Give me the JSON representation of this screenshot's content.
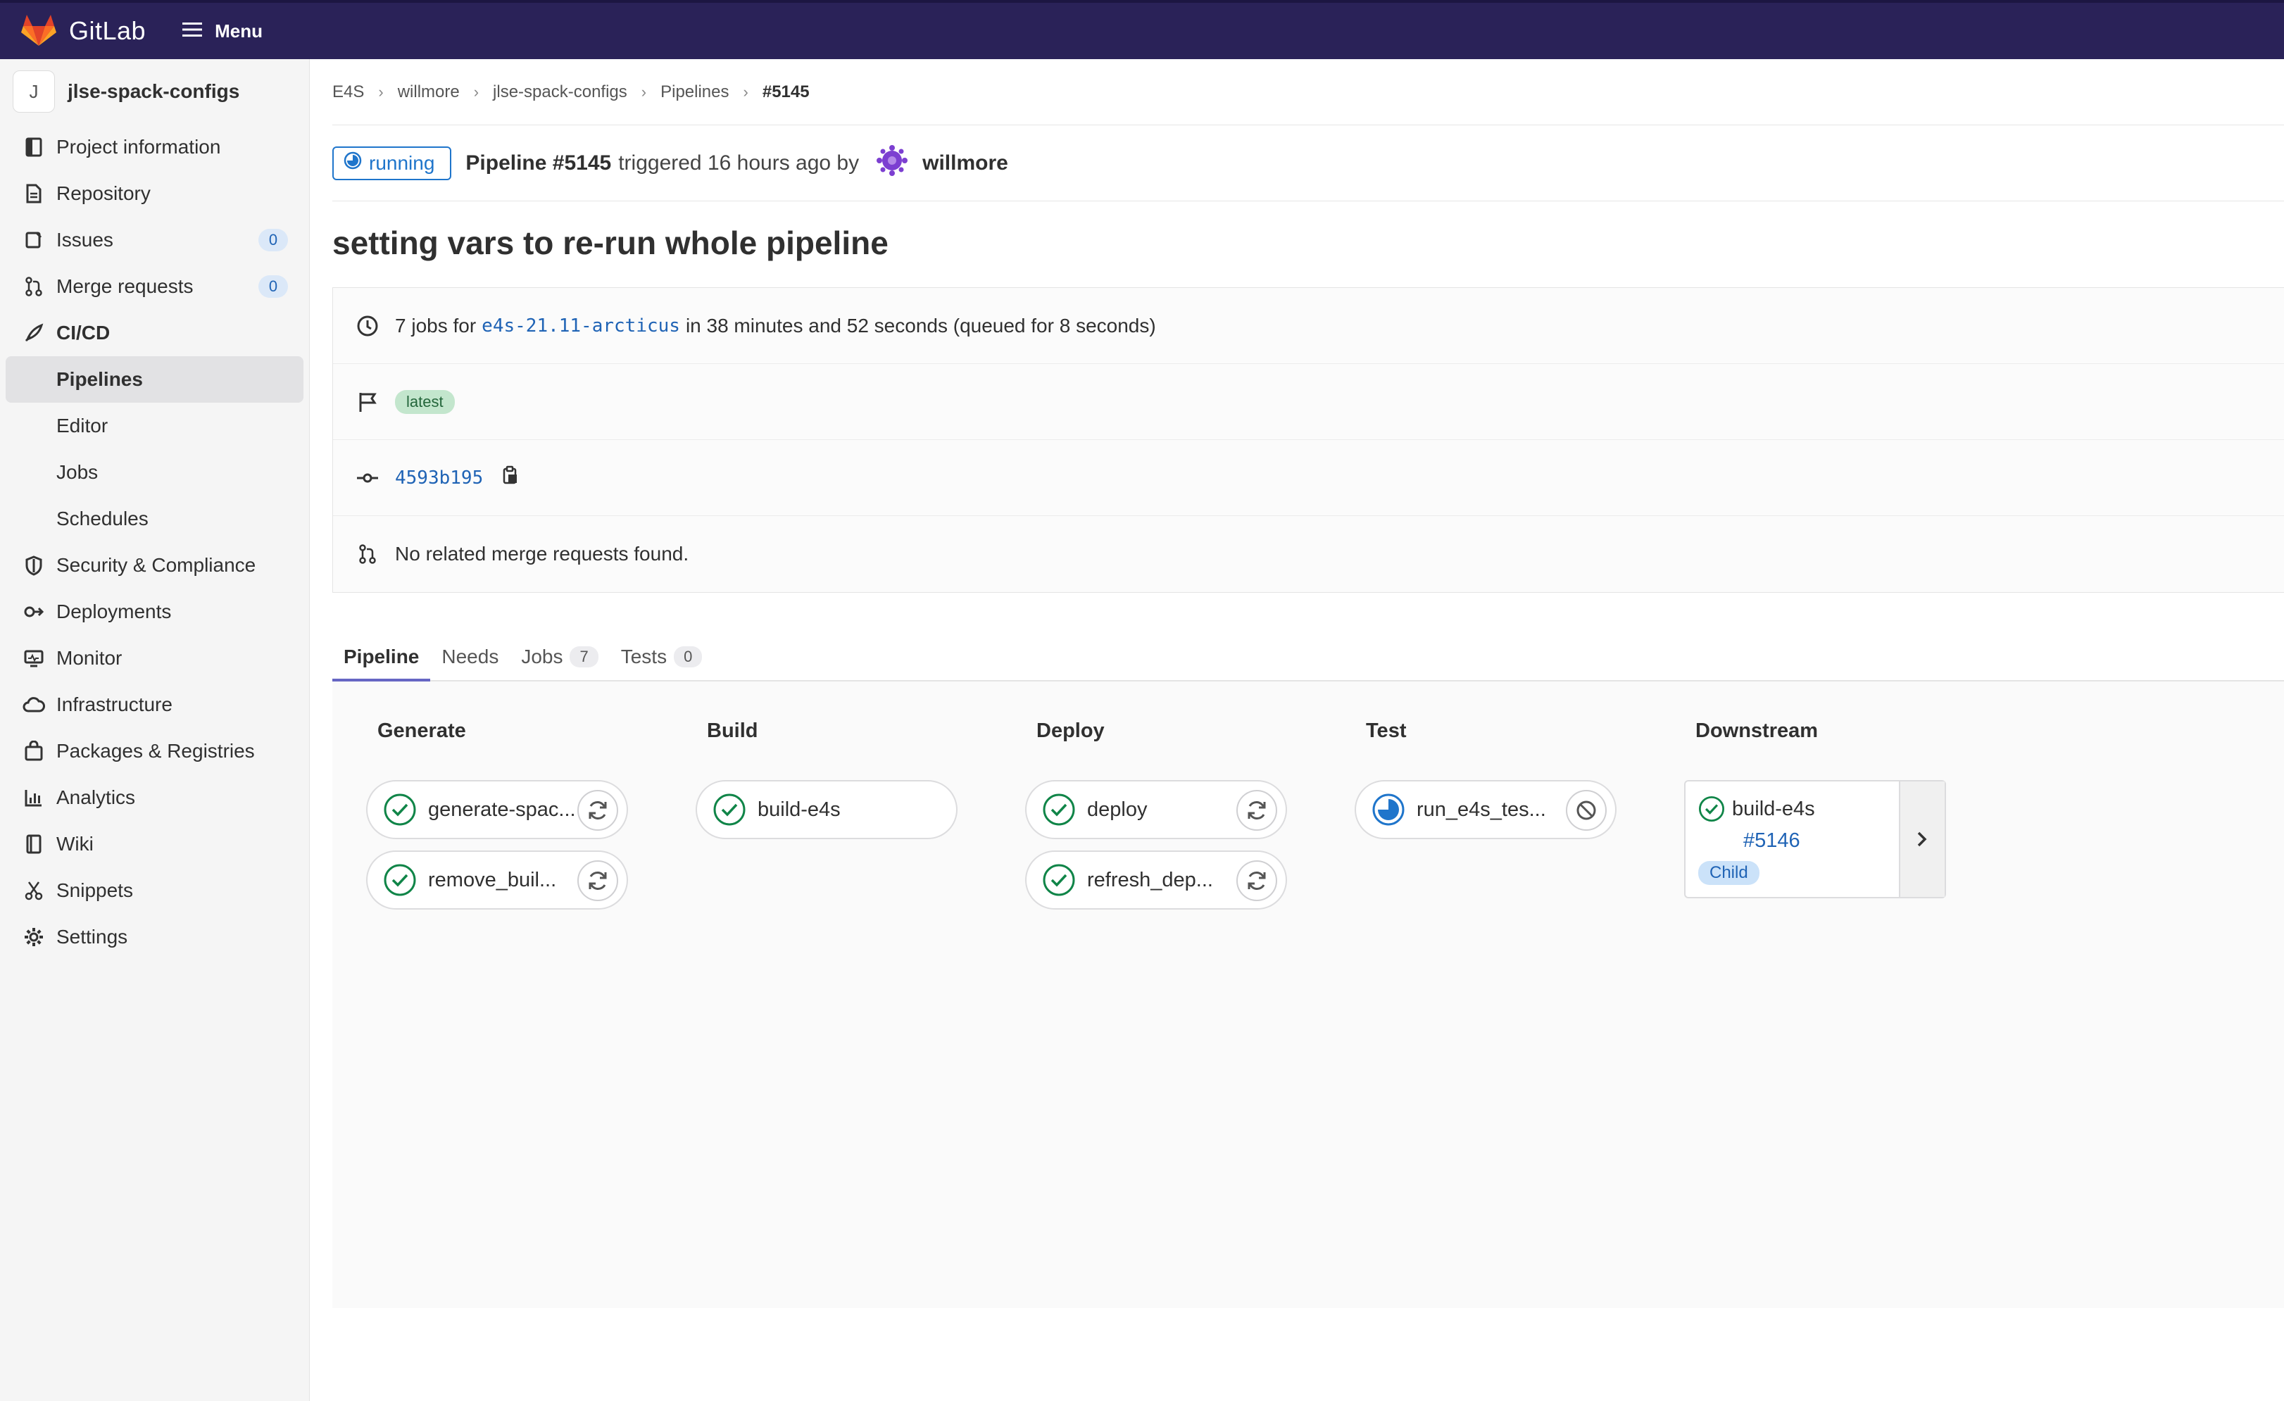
{
  "topbar": {
    "brand": "GitLab",
    "menu_label": "Menu"
  },
  "sidebar": {
    "project_initial": "J",
    "project_name": "jlse-spack-configs",
    "items": [
      {
        "label": "Project information",
        "icon": "book-icon"
      },
      {
        "label": "Repository",
        "icon": "doc-icon"
      },
      {
        "label": "Issues",
        "icon": "issues-icon",
        "count": "0"
      },
      {
        "label": "Merge requests",
        "icon": "merge-request-icon",
        "count": "0"
      },
      {
        "label": "CI/CD",
        "icon": "rocket-icon"
      },
      {
        "label": "Security & Compliance",
        "icon": "shield-icon"
      },
      {
        "label": "Deployments",
        "icon": "deployments-icon"
      },
      {
        "label": "Monitor",
        "icon": "monitor-icon"
      },
      {
        "label": "Infrastructure",
        "icon": "cloud-icon"
      },
      {
        "label": "Packages & Registries",
        "icon": "package-icon"
      },
      {
        "label": "Analytics",
        "icon": "chart-icon"
      },
      {
        "label": "Wiki",
        "icon": "wiki-icon"
      },
      {
        "label": "Snippets",
        "icon": "scissors-icon"
      },
      {
        "label": "Settings",
        "icon": "gear-icon"
      }
    ],
    "cicd_sub": [
      "Pipelines",
      "Editor",
      "Jobs",
      "Schedules"
    ]
  },
  "breadcrumb": [
    "E4S",
    "willmore",
    "jlse-spack-configs",
    "Pipelines",
    "#5145"
  ],
  "pipeline": {
    "status": "running",
    "title": "Pipeline #5145",
    "triggered": "triggered 16 hours ago by",
    "author": "willmore",
    "commit_title": "setting vars to re-run whole pipeline",
    "jobs_prefix": "7 jobs for",
    "ref": "e4s-21.11-arcticus",
    "jobs_suffix": "in 38 minutes and 52 seconds (queued for 8 seconds)",
    "tag": "latest",
    "sha": "4593b195",
    "mr_text": "No related merge requests found."
  },
  "tabs": [
    {
      "label": "Pipeline"
    },
    {
      "label": "Needs"
    },
    {
      "label": "Jobs",
      "count": "7"
    },
    {
      "label": "Tests",
      "count": "0"
    }
  ],
  "stages": [
    {
      "title": "Generate",
      "jobs": [
        {
          "name": "generate-spac...",
          "status": "success",
          "action": "retry"
        },
        {
          "name": "remove_buil...",
          "status": "success",
          "action": "retry"
        }
      ]
    },
    {
      "title": "Build",
      "jobs": [
        {
          "name": "build-e4s",
          "status": "success",
          "action": ""
        }
      ]
    },
    {
      "title": "Deploy",
      "jobs": [
        {
          "name": "deploy",
          "status": "success",
          "action": "retry"
        },
        {
          "name": "refresh_dep...",
          "status": "success",
          "action": "retry"
        }
      ]
    },
    {
      "title": "Test",
      "jobs": [
        {
          "name": "run_e4s_tes...",
          "status": "running",
          "action": "cancel"
        }
      ]
    },
    {
      "title": "Downstream",
      "downstream": {
        "name": "build-e4s",
        "id": "#5146",
        "badge": "Child"
      }
    }
  ],
  "colors": {
    "topbar": "#2a2258",
    "success": "#108548",
    "running": "#1f75cb",
    "link": "#1f63b5"
  }
}
